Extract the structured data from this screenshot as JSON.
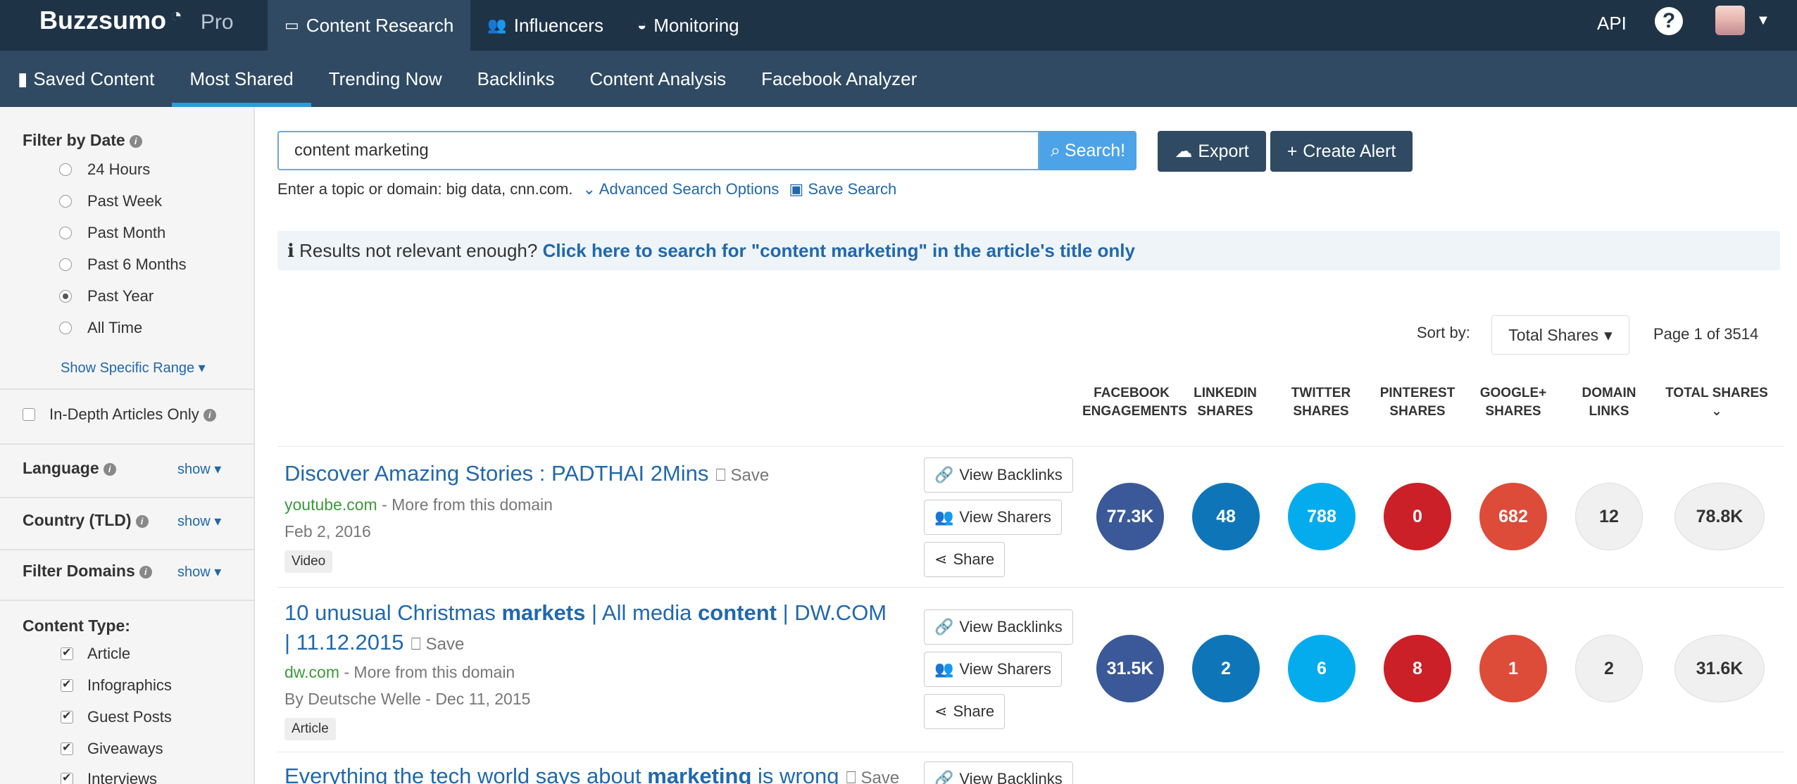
{
  "app": {
    "brand": "Buzzsumo",
    "edition": "Pro"
  },
  "topnav": {
    "items": [
      {
        "label": "Content Research"
      },
      {
        "label": "Influencers"
      },
      {
        "label": "Monitoring"
      }
    ],
    "api": "API",
    "help": "?"
  },
  "subnav": {
    "items": [
      {
        "label": "Saved Content"
      },
      {
        "label": "Most Shared"
      },
      {
        "label": "Trending Now"
      },
      {
        "label": "Backlinks"
      },
      {
        "label": "Content Analysis"
      },
      {
        "label": "Facebook Analyzer"
      }
    ]
  },
  "sidebar": {
    "filter_date_title": "Filter by Date",
    "date_options": [
      "24 Hours",
      "Past Week",
      "Past Month",
      "Past 6 Months",
      "Past Year",
      "All Time"
    ],
    "selected_date": "Past Year",
    "show_range": "Show Specific Range",
    "in_depth": "In-Depth Articles Only",
    "language": "Language",
    "country": "Country (TLD)",
    "filter_domains": "Filter Domains",
    "show": "show",
    "content_type_title": "Content Type:",
    "content_types": [
      "Article",
      "Infographics",
      "Guest Posts",
      "Giveaways",
      "Interviews"
    ]
  },
  "search": {
    "value": "content marketing",
    "button": "Search!",
    "export": "Export",
    "create_alert": "Create Alert",
    "hint": "Enter a topic or domain: big data, cnn.com.",
    "advanced": "Advanced Search Options",
    "save": "Save Search"
  },
  "notice": {
    "text": "Results not relevant enough?",
    "link": "Click here to search for \"content marketing\" in the article's title only"
  },
  "results": {
    "sort_label": "Sort by:",
    "sort_value": "Total Shares",
    "page_info": "Page 1 of 3514",
    "columns": [
      [
        "FACEBOOK",
        "ENGAGEMENTS"
      ],
      [
        "LINKEDIN",
        "SHARES"
      ],
      [
        "TWITTER",
        "SHARES"
      ],
      [
        "PINTEREST",
        "SHARES"
      ],
      [
        "GOOGLE+",
        "SHARES"
      ],
      [
        "DOMAIN",
        "LINKS"
      ],
      [
        "TOTAL SHARES",
        ""
      ]
    ],
    "save_label": "Save",
    "more_label": "- More from this domain",
    "actions": [
      "View Backlinks",
      "View Sharers",
      "Share"
    ],
    "articles": [
      {
        "title": "Discover Amazing Stories : PADTHAI 2Mins",
        "domain": "youtube.com",
        "date": "Feb 2, 2016",
        "tag": "Video",
        "facebook": "77.3K",
        "linkedin": "48",
        "twitter": "788",
        "pinterest": "0",
        "google": "682",
        "domain_links": "12",
        "total": "78.8K"
      },
      {
        "title_parts": [
          "10 unusual Christmas ",
          "markets",
          " | All media ",
          "content",
          " | DW.COM"
        ],
        "title_line2": "| 11.12.2015",
        "domain": "dw.com",
        "date": "By Deutsche Welle - Dec 11, 2015",
        "tag": "Article",
        "facebook": "31.5K",
        "linkedin": "2",
        "twitter": "6",
        "pinterest": "8",
        "google": "1",
        "domain_links": "2",
        "total": "31.6K"
      },
      {
        "title_parts": [
          "Everything the tech world says about ",
          "marketing",
          " is wrong"
        ],
        "action": "View Backlinks"
      }
    ]
  }
}
